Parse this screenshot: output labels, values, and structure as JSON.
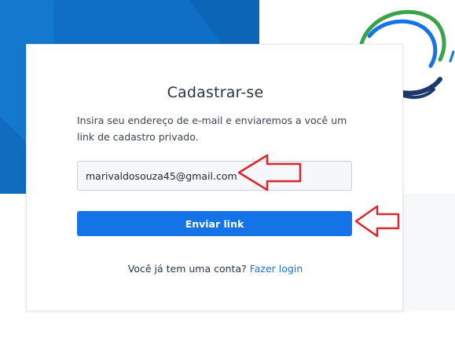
{
  "signup": {
    "title": "Cadastrar-se",
    "description": "Insira seu endereço de e-mail e enviaremos a você um link de cadastro privado.",
    "email_value": "marivaldosouza45@gmail.com",
    "email_placeholder": "",
    "send_label": "Enviar link",
    "footer_text": "Você já tem uma conta?",
    "login_link": "Fazer login"
  },
  "colors": {
    "brand_blue": "#0f6fc6",
    "button_blue": "#1473e6",
    "arrow_red": "#d9272e",
    "logo_green": "#3aa34a",
    "logo_navy": "#1b3a6b"
  },
  "icons": {
    "logo": "circular-swirl-logo",
    "annotation": "red-outline-arrow-icon"
  }
}
